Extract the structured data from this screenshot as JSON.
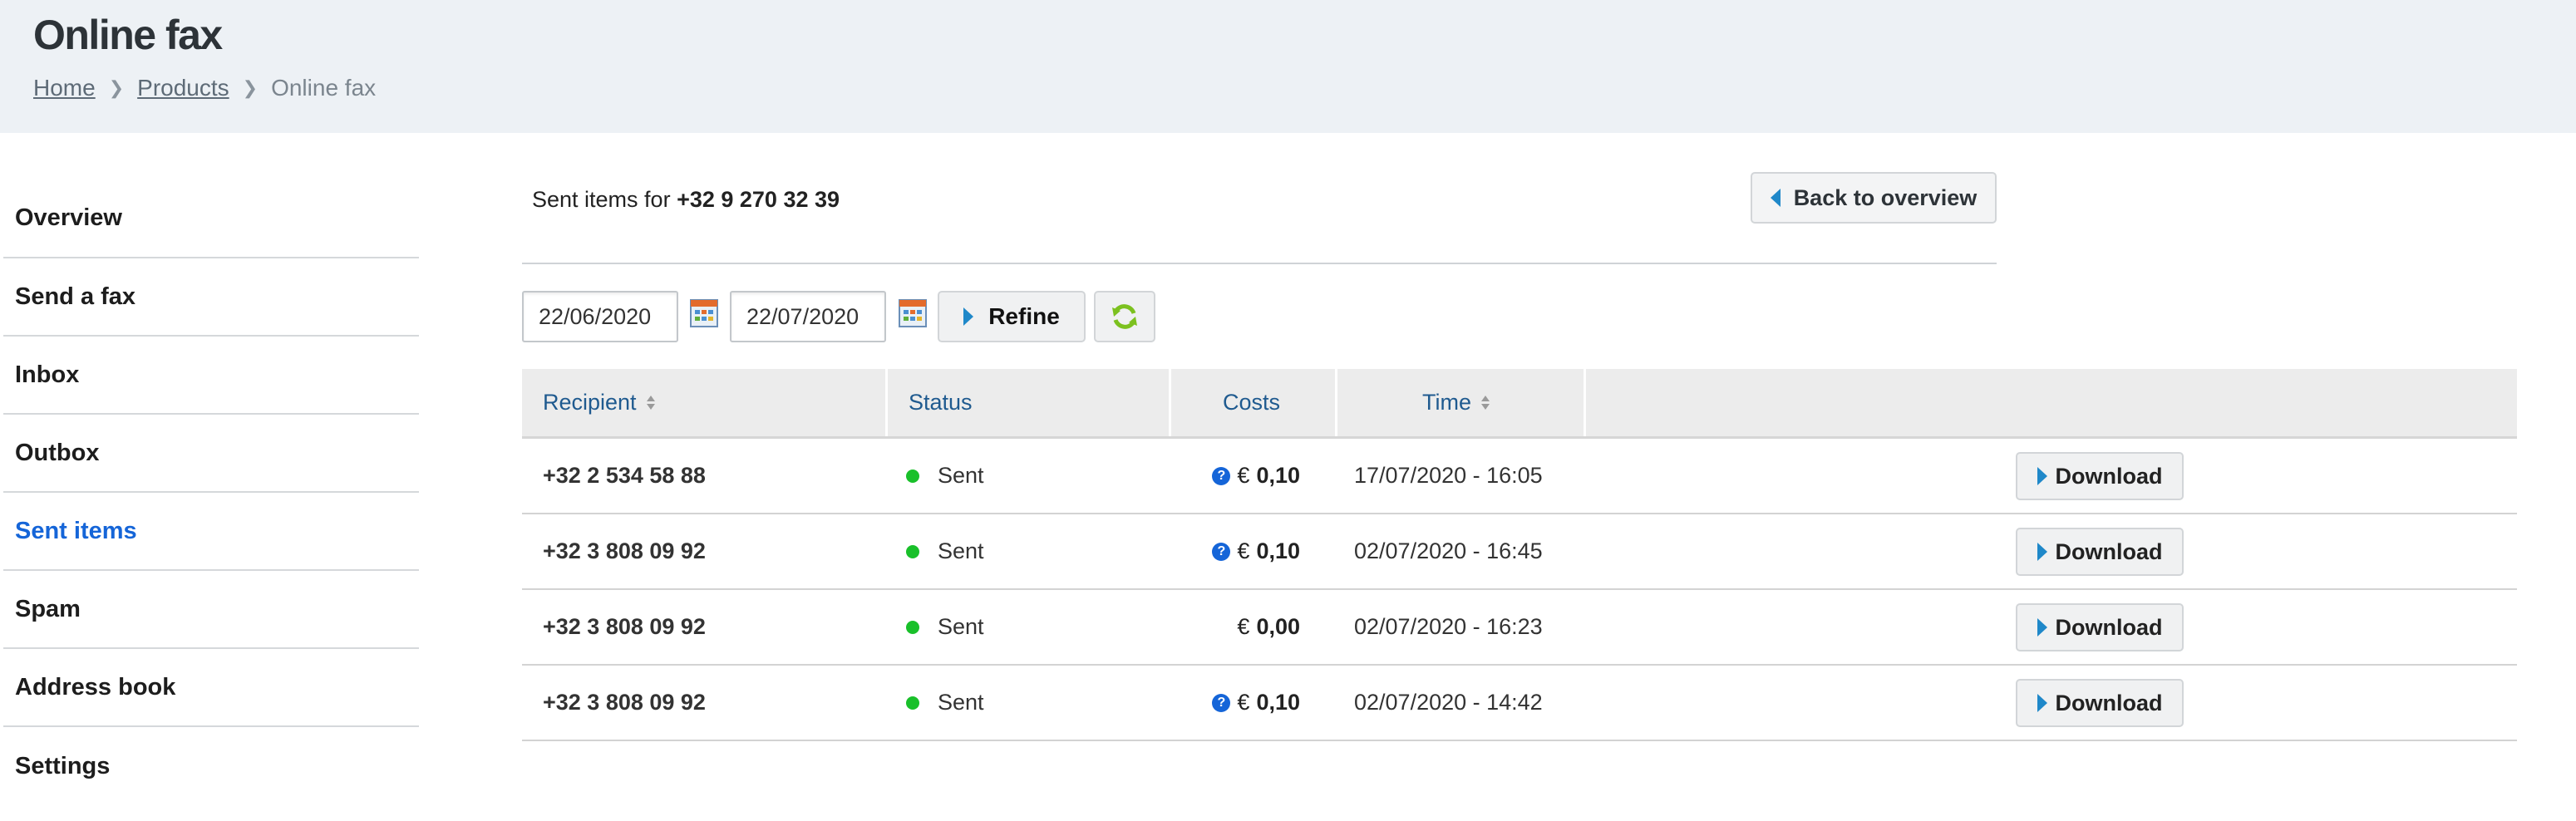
{
  "header": {
    "title": "Online fax",
    "breadcrumb": [
      {
        "label": "Home"
      },
      {
        "label": "Products"
      },
      {
        "label": "Online fax"
      }
    ],
    "separator": "❯"
  },
  "sidebar": {
    "items": [
      {
        "label": "Overview"
      },
      {
        "label": "Send a fax"
      },
      {
        "label": "Inbox"
      },
      {
        "label": "Outbox"
      },
      {
        "label": "Sent items",
        "active": true
      },
      {
        "label": "Spam"
      },
      {
        "label": "Address book"
      },
      {
        "label": "Settings"
      }
    ]
  },
  "main": {
    "sent_for_prefix": "Sent items for",
    "fax_number": "+32 9 270 32 39",
    "back_button": "Back to overview",
    "filter": {
      "from_date": "22/06/2020",
      "to_date": "22/07/2020",
      "refine_label": "Refine"
    },
    "table": {
      "columns": [
        "Recipient",
        "Status",
        "Costs",
        "Time"
      ],
      "currency": "€",
      "rows": [
        {
          "recipient": "+32 2 534 58 88",
          "status": "Sent",
          "cost": "0,10",
          "has_info": true,
          "time": "17/07/2020 - 16:05",
          "action": "Download"
        },
        {
          "recipient": "+32 3 808 09 92",
          "status": "Sent",
          "cost": "0,10",
          "has_info": true,
          "time": "02/07/2020 - 16:45",
          "action": "Download"
        },
        {
          "recipient": "+32 3 808 09 92",
          "status": "Sent",
          "cost": "0,00",
          "has_info": false,
          "time": "02/07/2020 - 16:23",
          "action": "Download"
        },
        {
          "recipient": "+32 3 808 09 92",
          "status": "Sent",
          "cost": "0,10",
          "has_info": true,
          "time": "02/07/2020 - 14:42",
          "action": "Download"
        }
      ]
    }
  },
  "colors": {
    "header_bg": "#edf1f5",
    "active_nav": "#1565d8",
    "column_header_text": "#1f5a8f",
    "status_sent": "#19c02a",
    "button_arrow": "#1f88c9"
  },
  "icons": {
    "calendar": "calendar-icon",
    "refresh": "refresh-icon",
    "info": "help-icon",
    "sort": "sort-icon"
  }
}
